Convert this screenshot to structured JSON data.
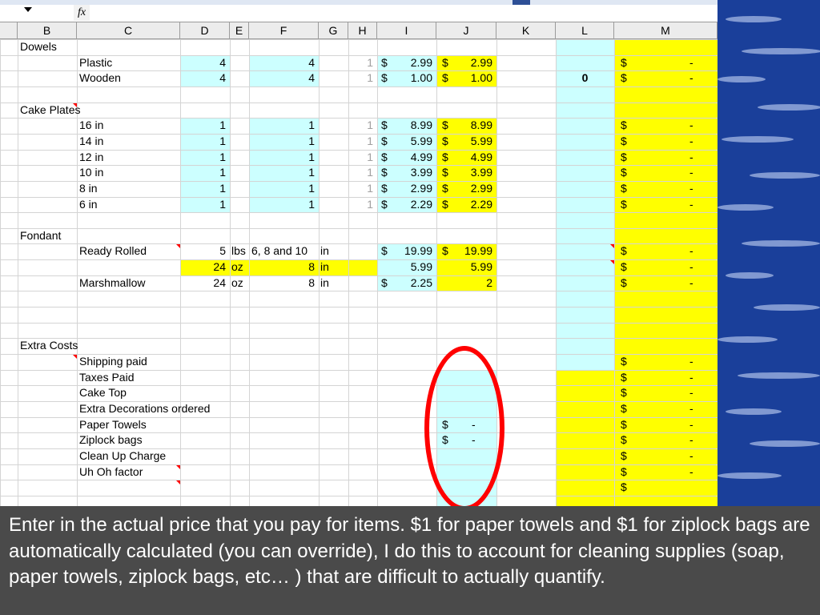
{
  "formula_bar": {
    "fx_label": "fx",
    "name_box": "",
    "formula": ""
  },
  "columns": [
    "B",
    "C",
    "D",
    "E",
    "F",
    "G",
    "H",
    "I",
    "J",
    "K",
    "L",
    "M"
  ],
  "rows": [
    {
      "b": "Dowels"
    },
    {
      "c": "Plastic",
      "d": "4",
      "f": "4",
      "h": "1",
      "i_cur": "$",
      "i": "2.99",
      "j_cur": "$",
      "j": "2.99",
      "m_cur": "$",
      "m": "-"
    },
    {
      "c": "Wooden",
      "d": "4",
      "f": "4",
      "h": "1",
      "i_cur": "$",
      "i": "1.00",
      "j_cur": "$",
      "j": "1.00",
      "l": "0",
      "m_cur": "$",
      "m": "-"
    },
    {},
    {
      "b": "Cake Plates"
    },
    {
      "c": "16 in",
      "d": "1",
      "f": "1",
      "h": "1",
      "i_cur": "$",
      "i": "8.99",
      "j_cur": "$",
      "j": "8.99",
      "m_cur": "$",
      "m": "-"
    },
    {
      "c": "14 in",
      "d": "1",
      "f": "1",
      "h": "1",
      "i_cur": "$",
      "i": "5.99",
      "j_cur": "$",
      "j": "5.99",
      "m_cur": "$",
      "m": "-"
    },
    {
      "c": "12 in",
      "d": "1",
      "f": "1",
      "h": "1",
      "i_cur": "$",
      "i": "4.99",
      "j_cur": "$",
      "j": "4.99",
      "m_cur": "$",
      "m": "-"
    },
    {
      "c": "10 in",
      "d": "1",
      "f": "1",
      "h": "1",
      "i_cur": "$",
      "i": "3.99",
      "j_cur": "$",
      "j": "3.99",
      "m_cur": "$",
      "m": "-"
    },
    {
      "c": "8 in",
      "d": "1",
      "f": "1",
      "h": "1",
      "i_cur": "$",
      "i": "2.99",
      "j_cur": "$",
      "j": "2.99",
      "m_cur": "$",
      "m": "-"
    },
    {
      "c": "6 in",
      "d": "1",
      "f": "1",
      "h": "1",
      "i_cur": "$",
      "i": "2.29",
      "j_cur": "$",
      "j": "2.29",
      "m_cur": "$",
      "m": "-"
    },
    {},
    {
      "b": "Fondant"
    },
    {
      "c": "Ready Rolled",
      "d": "5",
      "e": "lbs",
      "f": "6, 8 and 10",
      "g": "in",
      "i_cur": "$",
      "i": "19.99",
      "j_cur": "$",
      "j": "19.99",
      "m_cur": "$",
      "m": "-"
    },
    {
      "d": "24",
      "e": "oz",
      "f": "8",
      "g": "in",
      "i": "5.99",
      "j": "5.99",
      "m_cur": "$",
      "m": "-"
    },
    {
      "c": "Marshmallow",
      "d": "24",
      "e": "oz",
      "f": "8",
      "g": "in",
      "i_cur": "$",
      "i": "2.25",
      "j": "2",
      "m_cur": "$",
      "m": "-"
    },
    {},
    {},
    {},
    {
      "b": "Extra Costs"
    },
    {
      "c": "Shipping paid",
      "m_cur": "$",
      "m": "-"
    },
    {
      "c": "Taxes Paid",
      "m_cur": "$",
      "m": "-"
    },
    {
      "c": "Cake Top",
      "m_cur": "$",
      "m": "-"
    },
    {
      "c": "Extra Decorations ordered",
      "m_cur": "$",
      "m": "-"
    },
    {
      "c": "Paper Towels",
      "j_cur": "$",
      "j": "-",
      "m_cur": "$",
      "m": "-"
    },
    {
      "c": "Ziplock bags",
      "j_cur": "$",
      "j": "-",
      "m_cur": "$",
      "m": "-"
    },
    {
      "c": "Clean Up Charge",
      "m_cur": "$",
      "m": "-"
    },
    {
      "c": "Uh Oh factor",
      "m_cur": "$",
      "m": "-"
    },
    {
      "m_cur": "$"
    }
  ],
  "caption": "Enter in the actual price that you pay for items.  $1 for paper towels and $1 for ziplock bags are automatically calculated (you can override), I do this to account for cleaning supplies (soap, paper towels, ziplock bags, etc… ) that are difficult to actually quantify.",
  "colors": {
    "cyan": "#ccffff",
    "yellow": "#ffff00",
    "highlight_circle": "#ff0000",
    "caption_bg": "#4a4a4a",
    "side_bg": "#1a3f9a"
  }
}
